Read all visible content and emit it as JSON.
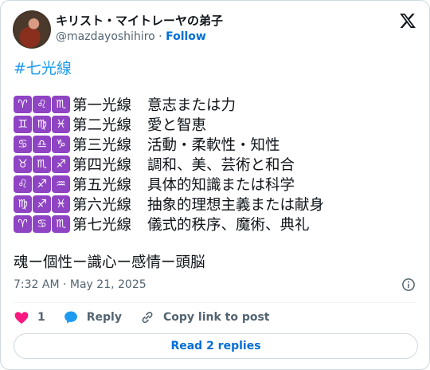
{
  "author": {
    "name": "キリスト・マイトレーヤの弟子",
    "handle": "@mazdayoshihiro",
    "separator": "·",
    "follow_label": "Follow"
  },
  "post": {
    "hashtag": "#七光線",
    "rows": [
      {
        "signs": [
          "♈",
          "♌",
          "♏"
        ],
        "label": "第一光線",
        "desc": "意志または力"
      },
      {
        "signs": [
          "♊",
          "♍",
          "♓"
        ],
        "label": "第二光線",
        "desc": "愛と智恵"
      },
      {
        "signs": [
          "♋",
          "♎",
          "♑"
        ],
        "label": "第三光線",
        "desc": "活動・柔軟性・知性"
      },
      {
        "signs": [
          "♉",
          "♏",
          "♐"
        ],
        "label": "第四光線",
        "desc": "調和、美、芸術と和合"
      },
      {
        "signs": [
          "♌",
          "♐",
          "♒"
        ],
        "label": "第五光線",
        "desc": "具体的知識または科学"
      },
      {
        "signs": [
          "♍",
          "♐",
          "♓"
        ],
        "label": "第六光線",
        "desc": "抽象的理想主義または献身"
      },
      {
        "signs": [
          "♈",
          "♋",
          "♏"
        ],
        "label": "第七光線",
        "desc": "儀式的秩序、魔術、典礼"
      }
    ],
    "line2": "魂ー個性ー識心ー感情ー頭脳",
    "timestamp": "7:32 AM · May 21, 2025"
  },
  "actions": {
    "like_count": "1",
    "reply_label": "Reply",
    "copy_label": "Copy link to post",
    "read_replies_label": "Read 2 replies"
  },
  "colors": {
    "accent": "#1d9bf0",
    "link": "#006fd6",
    "like": "#f91880",
    "zodiac_bg": "#8f44c4"
  },
  "icons": [
    "x-logo-icon",
    "info-icon",
    "heart-icon",
    "reply-bubble-icon",
    "link-icon"
  ]
}
